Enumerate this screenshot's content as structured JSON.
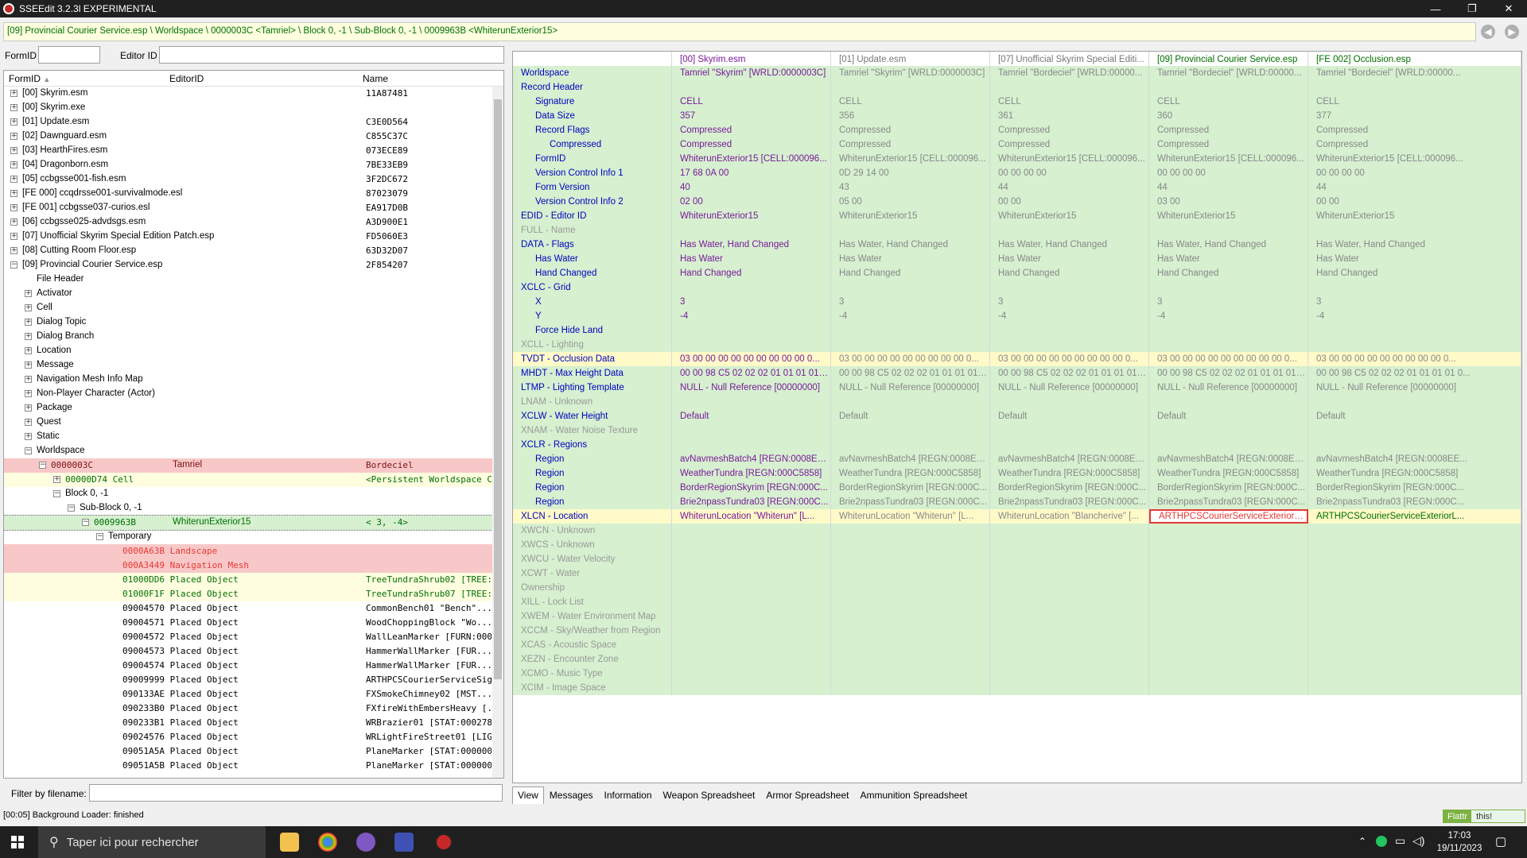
{
  "window": {
    "title": "SSEEdit 3.2.3l EXPERIMENTAL",
    "minimize": "—",
    "maximize": "❐",
    "close": "✕"
  },
  "path_bar": "[09] Provincial Courier Service.esp \\ Worldspace \\ 0000003C <Tamriel> \\ Block 0, -1 \\ Sub-Block 0, -1 \\ 0009963B <WhiterunExterior15>",
  "nav": {
    "back": "◀",
    "forward": "▶"
  },
  "search": {
    "formid_label": "FormID",
    "editorid_label": "Editor ID",
    "formid_value": "",
    "editorid_value": ""
  },
  "tree": {
    "headers": [
      "FormID",
      "EditorID",
      "Name"
    ],
    "sort_indicator": "▲",
    "rows": [
      {
        "id": "[00] Skyrim.esm",
        "name": "11A87481",
        "lvl": 0,
        "exp": "+"
      },
      {
        "id": "[00] Skyrim.exe",
        "name": "",
        "lvl": 0,
        "exp": "+"
      },
      {
        "id": "[01] Update.esm",
        "name": "C3E0D564",
        "lvl": 0,
        "exp": "+"
      },
      {
        "id": "[02] Dawnguard.esm",
        "name": "C855C37C",
        "lvl": 0,
        "exp": "+"
      },
      {
        "id": "[03] HearthFires.esm",
        "name": "073ECE89",
        "lvl": 0,
        "exp": "+"
      },
      {
        "id": "[04] Dragonborn.esm",
        "name": "7BE33EB9",
        "lvl": 0,
        "exp": "+"
      },
      {
        "id": "[05] ccbgsse001-fish.esm",
        "name": "3F2DC672",
        "lvl": 0,
        "exp": "+"
      },
      {
        "id": "[FE 000] ccqdrsse001-survivalmode.esl",
        "name": "87023079",
        "lvl": 0,
        "exp": "+"
      },
      {
        "id": "[FE 001] ccbgsse037-curios.esl",
        "name": "EA917D0B",
        "lvl": 0,
        "exp": "+"
      },
      {
        "id": "[06] ccbgsse025-advdsgs.esm",
        "name": "A3D900E1",
        "lvl": 0,
        "exp": "+"
      },
      {
        "id": "[07] Unofficial Skyrim Special Edition Patch.esp",
        "name": "FD5060E3",
        "lvl": 0,
        "exp": "+"
      },
      {
        "id": "[08] Cutting Room Floor.esp",
        "name": "63D32D07",
        "lvl": 0,
        "exp": "+"
      },
      {
        "id": "[09] Provincial Courier Service.esp",
        "name": "2F854207",
        "lvl": 0,
        "exp": "−"
      },
      {
        "id": "File Header",
        "name": "",
        "lvl": 1,
        "exp": ""
      },
      {
        "id": "Activator",
        "name": "",
        "lvl": 1,
        "exp": "+"
      },
      {
        "id": "Cell",
        "name": "",
        "lvl": 1,
        "exp": "+"
      },
      {
        "id": "Dialog Topic",
        "name": "",
        "lvl": 1,
        "exp": "+"
      },
      {
        "id": "Dialog Branch",
        "name": "",
        "lvl": 1,
        "exp": "+"
      },
      {
        "id": "Location",
        "name": "",
        "lvl": 1,
        "exp": "+"
      },
      {
        "id": "Message",
        "name": "",
        "lvl": 1,
        "exp": "+"
      },
      {
        "id": "Navigation Mesh Info Map",
        "name": "",
        "lvl": 1,
        "exp": "+"
      },
      {
        "id": "Non-Player Character (Actor)",
        "name": "",
        "lvl": 1,
        "exp": "+"
      },
      {
        "id": "Package",
        "name": "",
        "lvl": 1,
        "exp": "+"
      },
      {
        "id": "Quest",
        "name": "",
        "lvl": 1,
        "exp": "+"
      },
      {
        "id": "Static",
        "name": "",
        "lvl": 1,
        "exp": "+"
      },
      {
        "id": "Worldspace",
        "name": "",
        "lvl": 1,
        "exp": "−"
      },
      {
        "id": "0000003C",
        "eid": "Tamriel",
        "name": "Bordeciel",
        "lvl": 2,
        "exp": "−",
        "bg": "#f8c8c8",
        "color": "#7a1010",
        "mono": true
      },
      {
        "id": "00000D74  Cell",
        "eid": "",
        "name": "<Persistent Worldspace Ce...",
        "lvl": 3,
        "exp": "+",
        "bg": "#fffde0",
        "color": "#007000",
        "mono": true
      },
      {
        "id": "Block 0, -1",
        "name": "",
        "lvl": 3,
        "exp": "−"
      },
      {
        "id": "Sub-Block 0, -1",
        "name": "",
        "lvl": 4,
        "exp": "−"
      },
      {
        "id": "0009963B",
        "eid": "WhiterunExterior15",
        "name": "< 3, -4>",
        "lvl": 5,
        "exp": "−",
        "bg": "#d6f0d0",
        "color": "#007000",
        "mono": true,
        "sel": true
      },
      {
        "id": "Temporary",
        "name": "",
        "lvl": 6,
        "exp": "−"
      },
      {
        "id": "0000A63B  Landscape",
        "name": "",
        "lvl": 7,
        "exp": "",
        "bg": "#f8c8c8",
        "color": "#e53935",
        "mono": true
      },
      {
        "id": "000A3449  Navigation Mesh",
        "name": "",
        "lvl": 7,
        "exp": "",
        "bg": "#f8c8c8",
        "color": "#e53935",
        "mono": true
      },
      {
        "id": "01000DD6  Placed Object",
        "name": "TreeTundraShrub02 [TREE:0...",
        "lvl": 7,
        "exp": "",
        "bg": "#fffde0",
        "color": "#007000",
        "mono": true
      },
      {
        "id": "01000F1F  Placed Object",
        "name": "TreeTundraShrub07 [TREE:0...",
        "lvl": 7,
        "exp": "",
        "bg": "#fffde0",
        "color": "#007000",
        "mono": true
      },
      {
        "id": "09004570  Placed Object",
        "name": "CommonBench01 \"Bench\"...",
        "lvl": 7,
        "exp": "",
        "mono": true
      },
      {
        "id": "09004571  Placed Object",
        "name": "WoodChoppingBlock \"Wo...",
        "lvl": 7,
        "exp": "",
        "mono": true
      },
      {
        "id": "09004572  Placed Object",
        "name": "WallLeanMarker [FURN:000...",
        "lvl": 7,
        "exp": "",
        "mono": true
      },
      {
        "id": "09004573  Placed Object",
        "name": "HammerWallMarker [FUR...",
        "lvl": 7,
        "exp": "",
        "mono": true
      },
      {
        "id": "09004574  Placed Object",
        "name": "HammerWallMarker [FUR...",
        "lvl": 7,
        "exp": "",
        "mono": true
      },
      {
        "id": "09009999  Placed Object",
        "name": "ARTHPCSCourierServiceSig...",
        "lvl": 7,
        "exp": "",
        "mono": true
      },
      {
        "id": "090133AE  Placed Object",
        "name": "FXSmokeChimney02 [MST...",
        "lvl": 7,
        "exp": "",
        "mono": true
      },
      {
        "id": "090233B0  Placed Object",
        "name": "FXfireWithEmbersHeavy [...",
        "lvl": 7,
        "exp": "",
        "mono": true
      },
      {
        "id": "090233B1  Placed Object",
        "name": "WRBrazier01 [STAT:000278...",
        "lvl": 7,
        "exp": "",
        "mono": true
      },
      {
        "id": "09024576  Placed Object",
        "name": "WRLightFireStreet01 [LIGH:...",
        "lvl": 7,
        "exp": "",
        "mono": true
      },
      {
        "id": "09051A5A  Placed Object",
        "name": "PlaneMarker [STAT:000000...",
        "lvl": 7,
        "exp": "",
        "mono": true
      },
      {
        "id": "09051A5B  Placed Object",
        "name": "PlaneMarker [STAT:000000...",
        "lvl": 7,
        "exp": "",
        "mono": true
      }
    ]
  },
  "filter": {
    "label": "Filter by filename:",
    "value": ""
  },
  "grid": {
    "headers": [
      "",
      "[00] Skyrim.esm",
      "[01] Update.esm",
      "[07] Unofficial Skyrim Special Editi...",
      "[09] Provincial Courier Service.esp",
      "[FE 002] Occlusion.esp"
    ],
    "rows": [
      {
        "n": "Worldspace",
        "i": 0,
        "v": [
          "Tamriel \"Skyrim\" [WRLD:0000003C]",
          "Tamriel \"Skyrim\" [WRLD:0000003C]",
          "Tamriel \"Bordeciel\" [WRLD:00000...",
          "Tamriel \"Bordeciel\" [WRLD:00000...",
          "Tamriel \"Bordeciel\" [WRLD:00000..."
        ],
        "bg": "#d6f0d0"
      },
      {
        "n": "Record Header",
        "i": 0,
        "v": [
          "",
          "",
          "",
          "",
          ""
        ],
        "bg": "#d6f0d0"
      },
      {
        "n": "Signature",
        "i": 1,
        "v": [
          "CELL",
          "CELL",
          "CELL",
          "CELL",
          "CELL"
        ],
        "bg": "#d6f0d0"
      },
      {
        "n": "Data Size",
        "i": 1,
        "v": [
          "357",
          "356",
          "361",
          "360",
          "377"
        ],
        "bg": "#d6f0d0"
      },
      {
        "n": "Record Flags",
        "i": 1,
        "v": [
          "Compressed",
          "Compressed",
          "Compressed",
          "Compressed",
          "Compressed"
        ],
        "bg": "#d6f0d0"
      },
      {
        "n": "Compressed",
        "i": 2,
        "v": [
          "Compressed",
          "Compressed",
          "Compressed",
          "Compressed",
          "Compressed"
        ],
        "bg": "#d6f0d0"
      },
      {
        "n": "FormID",
        "i": 1,
        "v": [
          "WhiterunExterior15 [CELL:000096...",
          "WhiterunExterior15 [CELL:000096...",
          "WhiterunExterior15 [CELL:000096...",
          "WhiterunExterior15 [CELL:000096...",
          "WhiterunExterior15 [CELL:000096..."
        ],
        "bg": "#d6f0d0"
      },
      {
        "n": "Version Control Info 1",
        "i": 1,
        "v": [
          "17 68 0A 00",
          "0D 29 14 00",
          "00 00 00 00",
          "00 00 00 00",
          "00 00 00 00"
        ],
        "bg": "#d6f0d0"
      },
      {
        "n": "Form Version",
        "i": 1,
        "v": [
          "40",
          "43",
          "44",
          "44",
          "44"
        ],
        "bg": "#d6f0d0"
      },
      {
        "n": "Version Control Info 2",
        "i": 1,
        "v": [
          "02 00",
          "05 00",
          "00 00",
          "03 00",
          "00 00"
        ],
        "bg": "#d6f0d0"
      },
      {
        "n": "EDID - Editor ID",
        "i": 0,
        "v": [
          "WhiterunExterior15",
          "WhiterunExterior15",
          "WhiterunExterior15",
          "WhiterunExterior15",
          "WhiterunExterior15"
        ],
        "bg": "#d6f0d0"
      },
      {
        "n": "FULL - Name",
        "i": 0,
        "v": [
          "",
          "",
          "",
          "",
          ""
        ],
        "bg": "#d6f0d0",
        "empty": true
      },
      {
        "n": "DATA - Flags",
        "i": 0,
        "v": [
          "Has Water, Hand Changed",
          "Has Water, Hand Changed",
          "Has Water, Hand Changed",
          "Has Water, Hand Changed",
          "Has Water, Hand Changed"
        ],
        "bg": "#d6f0d0"
      },
      {
        "n": "Has Water",
        "i": 1,
        "v": [
          "Has Water",
          "Has Water",
          "Has Water",
          "Has Water",
          "Has Water"
        ],
        "bg": "#d6f0d0"
      },
      {
        "n": "Hand Changed",
        "i": 1,
        "v": [
          "Hand Changed",
          "Hand Changed",
          "Hand Changed",
          "Hand Changed",
          "Hand Changed"
        ],
        "bg": "#d6f0d0"
      },
      {
        "n": "XCLC - Grid",
        "i": 0,
        "v": [
          "",
          "",
          "",
          "",
          ""
        ],
        "bg": "#d6f0d0"
      },
      {
        "n": "X",
        "i": 1,
        "v": [
          "3",
          "3",
          "3",
          "3",
          "3"
        ],
        "bg": "#d6f0d0"
      },
      {
        "n": "Y",
        "i": 1,
        "v": [
          "-4",
          "-4",
          "-4",
          "-4",
          "-4"
        ],
        "bg": "#d6f0d0"
      },
      {
        "n": "Force Hide Land",
        "i": 1,
        "v": [
          "",
          "",
          "",
          "",
          ""
        ],
        "bg": "#d6f0d0"
      },
      {
        "n": "XCLL - Lighting",
        "i": 0,
        "v": [
          "",
          "",
          "",
          "",
          ""
        ],
        "bg": "#d6f0d0",
        "empty": true
      },
      {
        "n": "TVDT - Occlusion Data",
        "i": 0,
        "v": [
          "03 00 00 00 00 00 00 00 00 00 0...",
          "03 00 00 00 00 00 00 00 00 00 0...",
          "03 00 00 00 00 00 00 00 00 00 0...",
          "03 00 00 00 00 00 00 00 00 00 0...",
          "03 00 00 00 00 00 00 00 00 00 0..."
        ],
        "bg": "#fffac8"
      },
      {
        "n": "MHDT - Max Height Data",
        "i": 0,
        "v": [
          "00 00 98 C5 02 02 02 01 01 01 01 0...",
          "00 00 98 C5 02 02 02 01 01 01 01 0...",
          "00 00 98 C5 02 02 02 01 01 01 01 0...",
          "00 00 98 C5 02 02 02 01 01 01 01 0...",
          "00 00 98 C5 02 02 02 01 01 01 01 0..."
        ],
        "bg": "#d6f0d0"
      },
      {
        "n": "LTMP - Lighting Template",
        "i": 0,
        "v": [
          "NULL - Null Reference [00000000]",
          "NULL - Null Reference [00000000]",
          "NULL - Null Reference [00000000]",
          "NULL - Null Reference [00000000]",
          "NULL - Null Reference [00000000]"
        ],
        "bg": "#d6f0d0"
      },
      {
        "n": "LNAM - Unknown",
        "i": 0,
        "v": [
          "",
          "",
          "",
          "",
          ""
        ],
        "bg": "#d6f0d0",
        "empty": true
      },
      {
        "n": "XCLW - Water Height",
        "i": 0,
        "v": [
          "Default",
          "Default",
          "Default",
          "Default",
          "Default"
        ],
        "bg": "#d6f0d0"
      },
      {
        "n": "XNAM - Water Noise Texture",
        "i": 0,
        "v": [
          "",
          "",
          "",
          "",
          ""
        ],
        "bg": "#d6f0d0",
        "empty": true
      },
      {
        "n": "XCLR - Regions",
        "i": 0,
        "v": [
          "",
          "",
          "",
          "",
          ""
        ],
        "bg": "#d6f0d0"
      },
      {
        "n": "Region",
        "i": 1,
        "v": [
          "avNavmeshBatch4 [REGN:0008EE...",
          "avNavmeshBatch4 [REGN:0008EE...",
          "avNavmeshBatch4 [REGN:0008EE...",
          "avNavmeshBatch4 [REGN:0008EE...",
          "avNavmeshBatch4 [REGN:0008EE..."
        ],
        "bg": "#d6f0d0"
      },
      {
        "n": "Region",
        "i": 1,
        "v": [
          "WeatherTundra [REGN:000C5858]",
          "WeatherTundra [REGN:000C5858]",
          "WeatherTundra [REGN:000C5858]",
          "WeatherTundra [REGN:000C5858]",
          "WeatherTundra [REGN:000C5858]"
        ],
        "bg": "#d6f0d0"
      },
      {
        "n": "Region",
        "i": 1,
        "v": [
          "BorderRegionSkyrim [REGN:000C...",
          "BorderRegionSkyrim [REGN:000C...",
          "BorderRegionSkyrim [REGN:000C...",
          "BorderRegionSkyrim [REGN:000C...",
          "BorderRegionSkyrim [REGN:000C..."
        ],
        "bg": "#d6f0d0"
      },
      {
        "n": "Region",
        "i": 1,
        "v": [
          "Brie2npassTundra03 [REGN:000C...",
          "Brie2npassTundra03 [REGN:000C...",
          "Brie2npassTundra03 [REGN:000C...",
          "Brie2npassTundra03 [REGN:000C...",
          "Brie2npassTundra03 [REGN:000C..."
        ],
        "bg": "#d6f0d0"
      },
      {
        "n": "XLCN - Location",
        "i": 0,
        "v": [
          "WhiterunLocation \"Whiterun\" [L...",
          "WhiterunLocation \"Whiterun\" [L...",
          "WhiterunLocation \"Blancherive\" [...",
          "ARTHPCSCourierServiceExteriorL...",
          "ARTHPCSCourierServiceExteriorL..."
        ],
        "bg": "#fffac8",
        "hl": 3
      },
      {
        "n": "XWCN - Unknown",
        "i": 0,
        "v": [
          "",
          "",
          "",
          "",
          ""
        ],
        "bg": "#d6f0d0",
        "empty": true
      },
      {
        "n": "XWCS - Unknown",
        "i": 0,
        "v": [
          "",
          "",
          "",
          "",
          ""
        ],
        "bg": "#d6f0d0",
        "empty": true
      },
      {
        "n": "XWCU - Water Velocity",
        "i": 0,
        "v": [
          "",
          "",
          "",
          "",
          ""
        ],
        "bg": "#d6f0d0",
        "empty": true
      },
      {
        "n": "XCWT - Water",
        "i": 0,
        "v": [
          "",
          "",
          "",
          "",
          ""
        ],
        "bg": "#d6f0d0",
        "empty": true
      },
      {
        "n": "Ownership",
        "i": 0,
        "v": [
          "",
          "",
          "",
          "",
          ""
        ],
        "bg": "#d6f0d0",
        "empty": true
      },
      {
        "n": "XILL - Lock List",
        "i": 0,
        "v": [
          "",
          "",
          "",
          "",
          ""
        ],
        "bg": "#d6f0d0",
        "empty": true
      },
      {
        "n": "XWEM - Water Environment Map",
        "i": 0,
        "v": [
          "",
          "",
          "",
          "",
          ""
        ],
        "bg": "#d6f0d0",
        "empty": true
      },
      {
        "n": "XCCM - Sky/Weather from Region",
        "i": 0,
        "v": [
          "",
          "",
          "",
          "",
          ""
        ],
        "bg": "#d6f0d0",
        "empty": true
      },
      {
        "n": "XCAS - Acoustic Space",
        "i": 0,
        "v": [
          "",
          "",
          "",
          "",
          ""
        ],
        "bg": "#d6f0d0",
        "empty": true
      },
      {
        "n": "XEZN - Encounter Zone",
        "i": 0,
        "v": [
          "",
          "",
          "",
          "",
          ""
        ],
        "bg": "#d6f0d0",
        "empty": true
      },
      {
        "n": "XCMO - Music Type",
        "i": 0,
        "v": [
          "",
          "",
          "",
          "",
          ""
        ],
        "bg": "#d6f0d0",
        "empty": true
      },
      {
        "n": "XCIM - Image Space",
        "i": 0,
        "v": [
          "",
          "",
          "",
          "",
          ""
        ],
        "bg": "#d6f0d0",
        "empty": true
      }
    ]
  },
  "tabs": [
    "View",
    "Messages",
    "Information",
    "Weapon Spreadsheet",
    "Armor Spreadsheet",
    "Ammunition Spreadsheet"
  ],
  "status": "[00:05] Background Loader: finished",
  "flattr": {
    "label": "Flattr",
    "suffix": "this!"
  },
  "taskbar": {
    "search_placeholder": "Taper ici pour rechercher",
    "time": "17:03",
    "date": "19/11/2023"
  },
  "colors": {
    "header_blue": "#0000c0",
    "value_purple": "#7a1a9a",
    "dim": "#888888",
    "highlight": "#e53935"
  }
}
